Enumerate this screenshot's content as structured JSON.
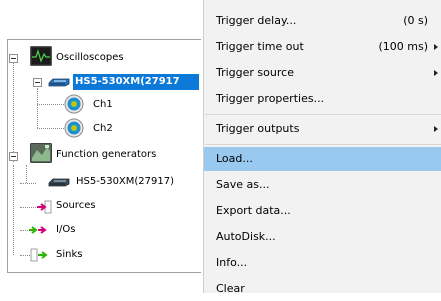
{
  "tree": {
    "oscilloscopes": "Oscilloscopes",
    "scope_device": "HS5-530XM(27917",
    "ch1": "Ch1",
    "ch2": "Ch2",
    "function_generators": "Function generators",
    "generator_device": "HS5-530XM(27917)",
    "sources": "Sources",
    "ios": "I/Os",
    "sinks": "Sinks"
  },
  "menu": {
    "items": [
      {
        "label": "Trigger delay...",
        "value": "(0 s)",
        "submenu": false
      },
      {
        "label": "Trigger time out",
        "value": "(100 ms)",
        "submenu": true
      },
      {
        "label": "Trigger source",
        "value": "",
        "submenu": true
      },
      {
        "label": "Trigger properties...",
        "value": "",
        "submenu": false
      },
      {
        "label": "Trigger outputs",
        "value": "",
        "submenu": true
      },
      {
        "label": "Load...",
        "value": "",
        "submenu": false,
        "highlighted": true
      },
      {
        "label": "Save as...",
        "value": "",
        "submenu": false
      },
      {
        "label": "Export data...",
        "value": "",
        "submenu": false
      },
      {
        "label": "AutoDisk...",
        "value": "",
        "submenu": false
      },
      {
        "label": "Info...",
        "value": "",
        "submenu": false
      },
      {
        "label": "Clear",
        "value": "",
        "submenu": false
      }
    ]
  },
  "colors": {
    "selection": "#0c78d7",
    "menu_highlight": "#99c9ef",
    "arrow_sources": "#d4007a",
    "arrow_ios": "#2db300",
    "channel_ring": "#1a8fd6",
    "channel_core": "#b5c800"
  }
}
